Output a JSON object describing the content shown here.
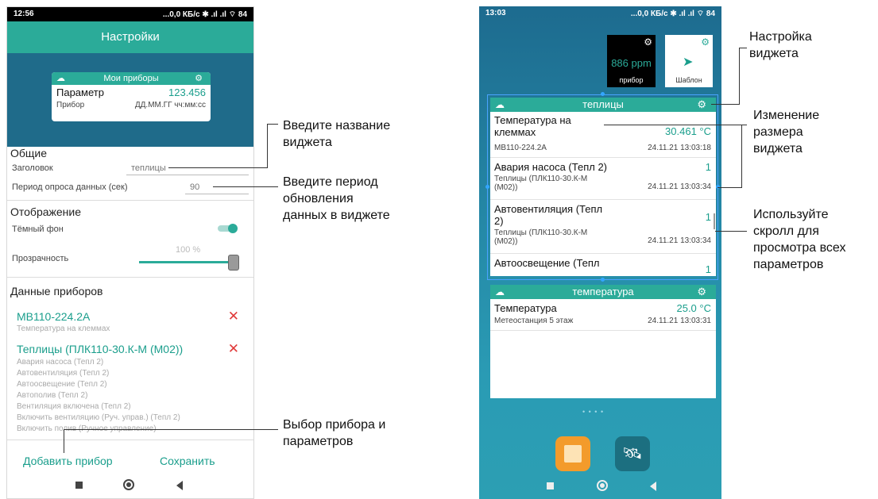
{
  "left_phone": {
    "status": {
      "time": "12:56",
      "right": "...0,0 КБ/с ✱ .ıl .ıl ⌔ 84"
    },
    "title": "Настройки",
    "preview": {
      "title": "Мои приборы",
      "param": "Параметр",
      "value": "123.456",
      "device": "Прибор",
      "datetime": "ДД.ММ.ГГ чч:мм:сс"
    },
    "general": {
      "heading": "Общие",
      "title_label": "Заголовок",
      "title_value": "теплицы",
      "period_label": "Период опроса данных (сек)",
      "period_value": "90"
    },
    "display": {
      "heading": "Отображение",
      "dark_label": "Тёмный фон",
      "opacity_label": "Прозрачность",
      "opacity_value": "100 %"
    },
    "devices": {
      "heading": "Данные приборов",
      "list": [
        {
          "name": "МВ110-224.2А",
          "params": [
            "Температура на клеммах"
          ]
        },
        {
          "name": "Теплицы (ПЛК110-30.К-М (М02))",
          "params": [
            "Авария насоса (Тепл 2)",
            "Автовентиляция (Тепл 2)",
            "Автоосвещение (Тепл 2)",
            "Автополив (Тепл 2)",
            "Вентиляция включена (Тепл 2)",
            "Включить вентиляцию (Руч. управ.) (Тепл 2)",
            "Включить полив (Ручное управление)"
          ]
        }
      ]
    },
    "add_button": "Добавить прибор",
    "save_button": "Сохранить"
  },
  "annotations_left": {
    "name": "Введите название\nвиджета",
    "period": "Введите период\nобновления\nданных в виджете",
    "device": "Выбор прибора и\nпараметров"
  },
  "right_phone": {
    "status": {
      "time": "13:03",
      "right": "...0,0 КБ/с ✱ .ıl .ıl ⌔ 84"
    },
    "mini1": {
      "value": "886 ppm",
      "label": "прибор"
    },
    "mini2": {
      "label": "Шаблон"
    },
    "widget1": {
      "title": "теплицы",
      "rows": [
        {
          "name": "Температура на\nклеммах",
          "value": "30.461 °C",
          "sub": "МВ110-224.2А",
          "time": "24.11.21 13:03:18"
        },
        {
          "name": "Авария насоса (Тепл 2)",
          "value": "1",
          "sub": "Теплицы (ПЛК110-30.К-М\n(М02))",
          "time": "24.11.21 13:03:34"
        },
        {
          "name": "Автовентиляция (Тепл\n2)",
          "value": "1",
          "sub": "Теплицы (ПЛК110-30.К-М\n(М02))",
          "time": "24.11.21 13:03:34"
        },
        {
          "name": "Автоосвещение (Тепл",
          "value": "1",
          "sub": "",
          "time": ""
        }
      ]
    },
    "widget2": {
      "title": "температура",
      "rows": [
        {
          "name": "Температура",
          "value": "25.0 °C",
          "sub": "Метеостанция 5 этаж",
          "time": "24.11.21 13:03:31"
        }
      ]
    },
    "page_dots": "• • • •"
  },
  "annotations_right": {
    "settings": "Настройка\nвиджета",
    "resize": "Изменение\nразмера\nвиджета",
    "scroll": "Используйте\nскролл для\nпросмотра всех\nпараметров"
  },
  "colors": {
    "accent": "#2bab99",
    "teal_text": "#1a9e8c",
    "remove": "#e03a3a",
    "wall": "#1f6b8a"
  }
}
